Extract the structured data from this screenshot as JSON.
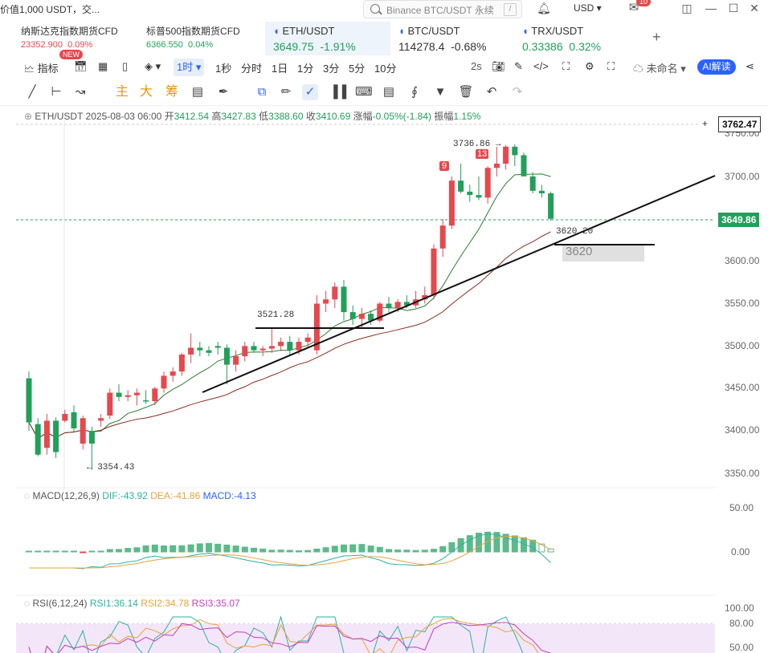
{
  "topbar": {
    "promo": "价值1,000 USDT，交...",
    "search_placeholder": "Binance BTC/USDT 永续",
    "slash": "/",
    "currency": "USD",
    "notify_count": "10"
  },
  "tabs": [
    {
      "name": "纳斯达克指数期货CFD",
      "price": "23352.900",
      "change": "0.09%",
      "color": "#e5484d"
    },
    {
      "name": "标普500指数期货CFD",
      "price": "6366.550",
      "change": "0.04%",
      "color": "#21a05a"
    },
    {
      "name": "ETH/USDT",
      "price": "3649.75",
      "change": "-1.91%",
      "color": "#21a05a"
    },
    {
      "name": "BTC/USDT",
      "price": "114278.4",
      "change": "-0.68%",
      "color": "#333333"
    },
    {
      "name": "TRX/USDT",
      "price": "0.33386",
      "change": "0.32%",
      "color": "#21a05a"
    }
  ],
  "toolbar": {
    "indicator": "指标",
    "new_badge": "NEW",
    "interval_selected": "1时",
    "intervals": [
      "1秒",
      "分时",
      "1日",
      "1分",
      "3分",
      "5分",
      "10分"
    ],
    "refresh": "2s",
    "layout_name": "未命名",
    "ai_label": "AI解读"
  },
  "drawtools": {
    "labels": [
      "主",
      "大",
      "筹"
    ]
  },
  "ohlc": {
    "symbol": "ETH/USDT",
    "datetime": "2025-08-03 06:00",
    "open_label": "开",
    "open": "3412.54",
    "high_label": "高",
    "high": "3427.83",
    "low_label": "低",
    "low": "3388.60",
    "close_label": "收",
    "close": "3410.69",
    "change_label": "涨幅",
    "change": "-0.05%(-1.84)",
    "amp_label": "振幅",
    "amplitude": "1.15%"
  },
  "price_axis": {
    "ticks": [
      "3750.00",
      "3700.00",
      "3600.00",
      "3550.00",
      "3500.00",
      "3450.00",
      "3400.00",
      "3350.00"
    ],
    "crosshair_price": "3762.47",
    "last_price": "3649.86",
    "colors": {
      "up": "#e5484d",
      "down": "#21a05a",
      "last": "#21a05a"
    }
  },
  "annotations": {
    "high_mark": "3736.86",
    "low_mark": "3354.43",
    "level_mid": "3521.28",
    "level_right": "3620.20",
    "level_box": "3620",
    "count_9": "9",
    "count_13": "13"
  },
  "macd": {
    "label": "MACD(12,26,9)",
    "dif": "DIF:-43.92",
    "dea": "DEA:-41.86",
    "macd": "MACD:-4.13",
    "ticks": [
      "50.00",
      "0.00"
    ],
    "colors": {
      "dif": "#2bb3a3",
      "dea": "#e8a33d",
      "macd": "#2962ff"
    }
  },
  "rsi": {
    "label": "RSI(6,12,24)",
    "rsi1": "RSI1:36.14",
    "rsi2": "RSI2:34.78",
    "rsi3": "RSI3:35.07",
    "ticks": [
      "100.00",
      "80.00",
      "50.00"
    ],
    "colors": {
      "rsi1": "#2bb3a3",
      "rsi2": "#e8a33d",
      "rsi3": "#c040c0"
    }
  },
  "chart_data": {
    "type": "candlestick",
    "symbol": "ETH/USDT",
    "interval": "1时",
    "ylim": [
      3330,
      3770
    ],
    "candles": [
      [
        3462,
        3470,
        3400,
        3410
      ],
      [
        3408,
        3415,
        3370,
        3372
      ],
      [
        3380,
        3420,
        3372,
        3412
      ],
      [
        3412,
        3416,
        3368,
        3375
      ],
      [
        3412,
        3425,
        3410,
        3420
      ],
      [
        3422,
        3430,
        3398,
        3403
      ],
      [
        3385,
        3418,
        3378,
        3415
      ],
      [
        3400,
        3405,
        3354,
        3385
      ],
      [
        3412,
        3420,
        3405,
        3415
      ],
      [
        3418,
        3450,
        3414,
        3445
      ],
      [
        3445,
        3455,
        3435,
        3440
      ],
      [
        3440,
        3448,
        3435,
        3442
      ],
      [
        3442,
        3450,
        3430,
        3445
      ],
      [
        3436,
        3448,
        3432,
        3435
      ],
      [
        3435,
        3452,
        3430,
        3450
      ],
      [
        3450,
        3470,
        3445,
        3465
      ],
      [
        3465,
        3475,
        3458,
        3470
      ],
      [
        3470,
        3492,
        3465,
        3490
      ],
      [
        3490,
        3515,
        3480,
        3498
      ],
      [
        3498,
        3505,
        3488,
        3495
      ],
      [
        3495,
        3500,
        3488,
        3492
      ],
      [
        3500,
        3505,
        3490,
        3498
      ],
      [
        3498,
        3502,
        3455,
        3478
      ],
      [
        3478,
        3495,
        3470,
        3488
      ],
      [
        3488,
        3505,
        3482,
        3500
      ],
      [
        3500,
        3505,
        3492,
        3495
      ],
      [
        3495,
        3500,
        3488,
        3497
      ],
      [
        3497,
        3520,
        3492,
        3500
      ],
      [
        3500,
        3510,
        3494,
        3505
      ],
      [
        3505,
        3512,
        3490,
        3495
      ],
      [
        3495,
        3510,
        3490,
        3505
      ],
      [
        3505,
        3515,
        3498,
        3510
      ],
      [
        3495,
        3560,
        3490,
        3550
      ],
      [
        3550,
        3565,
        3540,
        3555
      ],
      [
        3555,
        3575,
        3545,
        3570
      ],
      [
        3570,
        3578,
        3530,
        3540
      ],
      [
        3540,
        3548,
        3525,
        3532
      ],
      [
        3532,
        3545,
        3520,
        3538
      ],
      [
        3538,
        3542,
        3525,
        3530
      ],
      [
        3530,
        3552,
        3528,
        3550
      ],
      [
        3550,
        3558,
        3540,
        3545
      ],
      [
        3545,
        3555,
        3540,
        3552
      ],
      [
        3552,
        3560,
        3545,
        3548
      ],
      [
        3548,
        3565,
        3545,
        3555
      ],
      [
        3555,
        3570,
        3550,
        3560
      ],
      [
        3560,
        3620,
        3555,
        3615
      ],
      [
        3615,
        3650,
        3605,
        3642
      ],
      [
        3642,
        3700,
        3638,
        3695
      ],
      [
        3695,
        3715,
        3680,
        3682
      ],
      [
        3682,
        3690,
        3670,
        3678
      ],
      [
        3678,
        3700,
        3672,
        3675
      ],
      [
        3675,
        3712,
        3668,
        3710
      ],
      [
        3710,
        3735,
        3700,
        3715
      ],
      [
        3715,
        3737,
        3708,
        3735
      ],
      [
        3735,
        3738,
        3712,
        3725
      ],
      [
        3725,
        3728,
        3700,
        3700
      ],
      [
        3700,
        3705,
        3680,
        3683
      ],
      [
        3683,
        3690,
        3675,
        3680
      ],
      [
        3680,
        3682,
        3648,
        3650
      ]
    ],
    "ma_fast_label": "MA",
    "annotations_prices": [
      3736.86,
      3354.43,
      3521.28,
      3620.2
    ]
  }
}
